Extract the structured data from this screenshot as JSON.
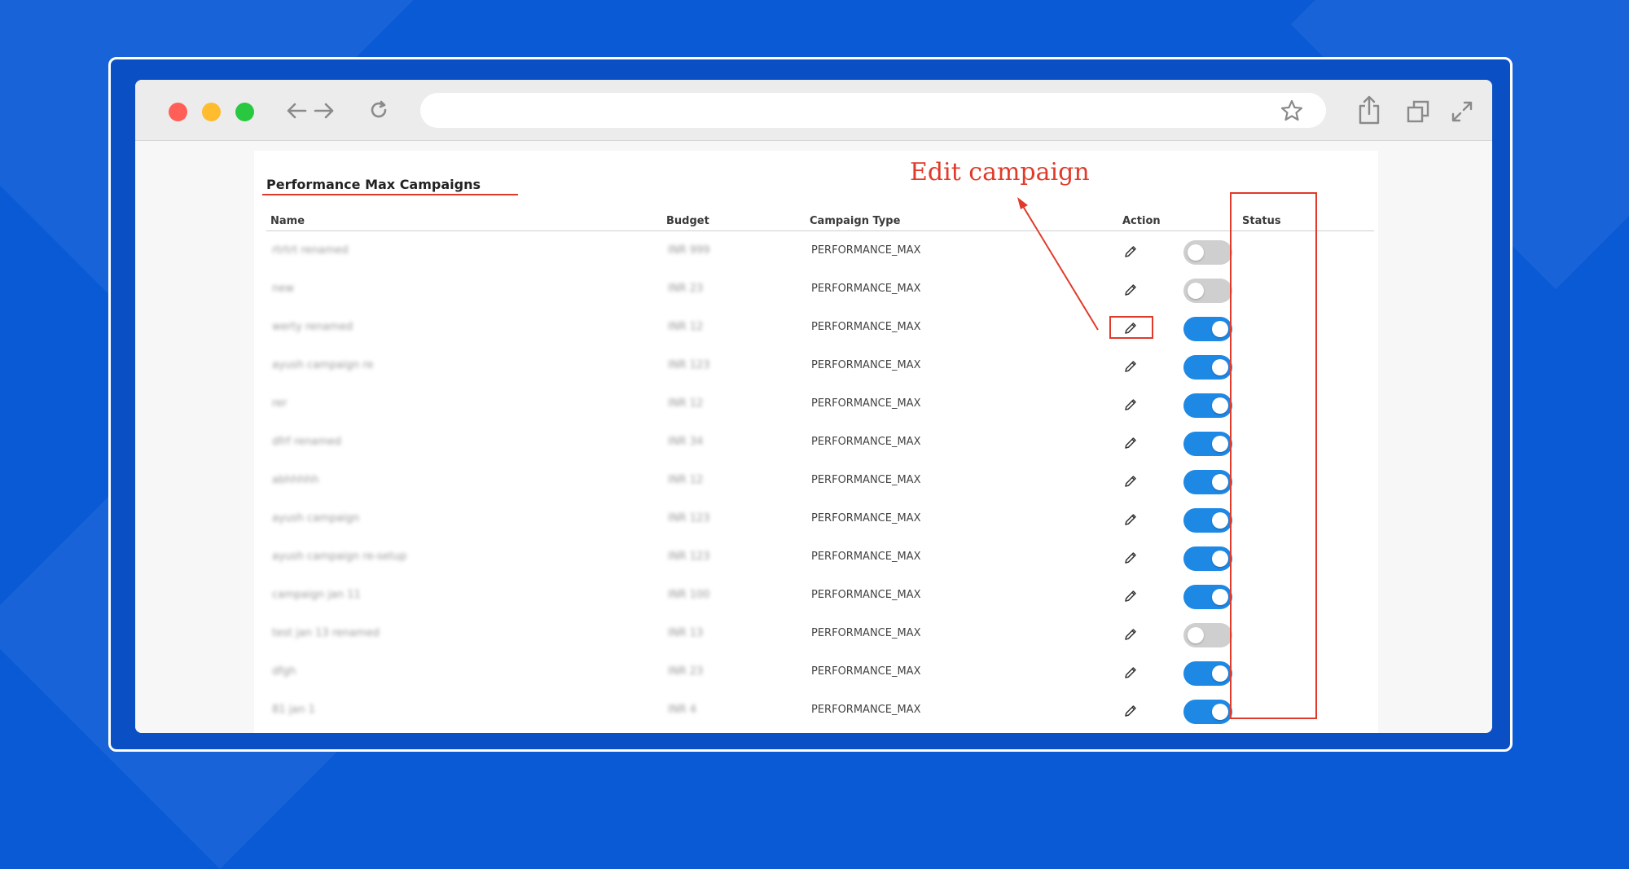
{
  "annotation": {
    "edit_label": "Edit campaign",
    "color": "#e03b2a"
  },
  "browser": {
    "traffic_lights": [
      "#ff5f57",
      "#febc2e",
      "#28c840"
    ],
    "url": "",
    "icons": [
      "back-arrow-icon",
      "forward-arrow-icon",
      "reload-icon",
      "star-icon",
      "share-icon",
      "tabs-icon",
      "fullscreen-icon"
    ]
  },
  "panel": {
    "title": "Performance Max Campaigns",
    "columns": {
      "name": "Name",
      "budget": "Budget",
      "type": "Campaign Type",
      "action": "Action",
      "status": "Status"
    },
    "rows": [
      {
        "name": "rtrtrt renamed",
        "budget": "INR 999",
        "type": "PERFORMANCE_MAX",
        "status": "off"
      },
      {
        "name": "new",
        "budget": "INR 23",
        "type": "PERFORMANCE_MAX",
        "status": "off"
      },
      {
        "name": "werty renamed",
        "budget": "INR 12",
        "type": "PERFORMANCE_MAX",
        "status": "on"
      },
      {
        "name": "ayush campaign re",
        "budget": "INR 123",
        "type": "PERFORMANCE_MAX",
        "status": "on"
      },
      {
        "name": "rer",
        "budget": "INR 12",
        "type": "PERFORMANCE_MAX",
        "status": "on"
      },
      {
        "name": "dfrf renamed",
        "budget": "INR 34",
        "type": "PERFORMANCE_MAX",
        "status": "on"
      },
      {
        "name": "abhhhhh",
        "budget": "INR 12",
        "type": "PERFORMANCE_MAX",
        "status": "on"
      },
      {
        "name": "ayush campaign",
        "budget": "INR 123",
        "type": "PERFORMANCE_MAX",
        "status": "on"
      },
      {
        "name": "ayush campaign re-setup",
        "budget": "INR 123",
        "type": "PERFORMANCE_MAX",
        "status": "on"
      },
      {
        "name": "campaign jan 11",
        "budget": "INR 100",
        "type": "PERFORMANCE_MAX",
        "status": "on"
      },
      {
        "name": "test jan 13 renamed",
        "budget": "INR 13",
        "type": "PERFORMANCE_MAX",
        "status": "off"
      },
      {
        "name": "dfgh",
        "budget": "INR 23",
        "type": "PERFORMANCE_MAX",
        "status": "on"
      },
      {
        "name": "81 jan 1",
        "budget": "INR 4",
        "type": "PERFORMANCE_MAX",
        "status": "on"
      }
    ]
  }
}
